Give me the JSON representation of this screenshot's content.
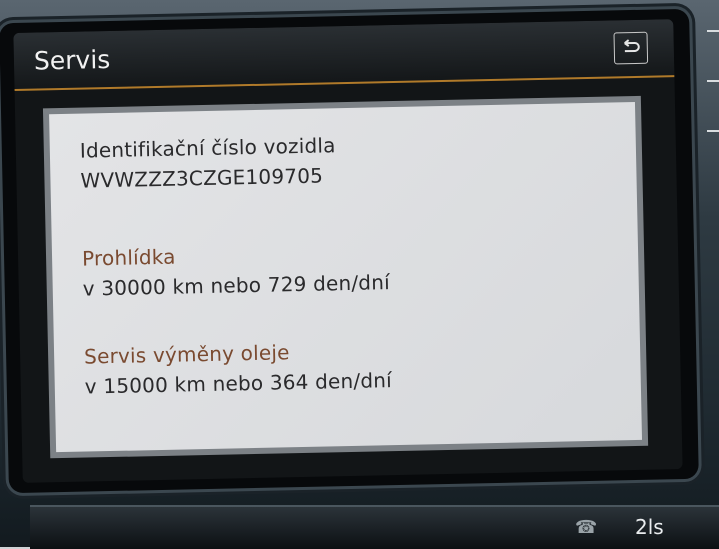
{
  "header": {
    "title": "Servis",
    "back_icon": "return-arrow-icon"
  },
  "info": {
    "vin_label": "Identifikační číslo vozidla",
    "vin_value": "WVWZZZ3CZGE109705",
    "inspection_label": "Prohlídka",
    "inspection_value": "v 30000 km nebo 729 den/dní",
    "oil_label": "Servis výměny oleje",
    "oil_value": "v 15000 km nebo 364 den/dní"
  },
  "console": {
    "phone_icon": "phone-icon",
    "button_text": "2ls"
  },
  "colors": {
    "accent_line": "#b07a2a",
    "panel_bg": "#e3e4e6",
    "header_bg": "#141719"
  }
}
